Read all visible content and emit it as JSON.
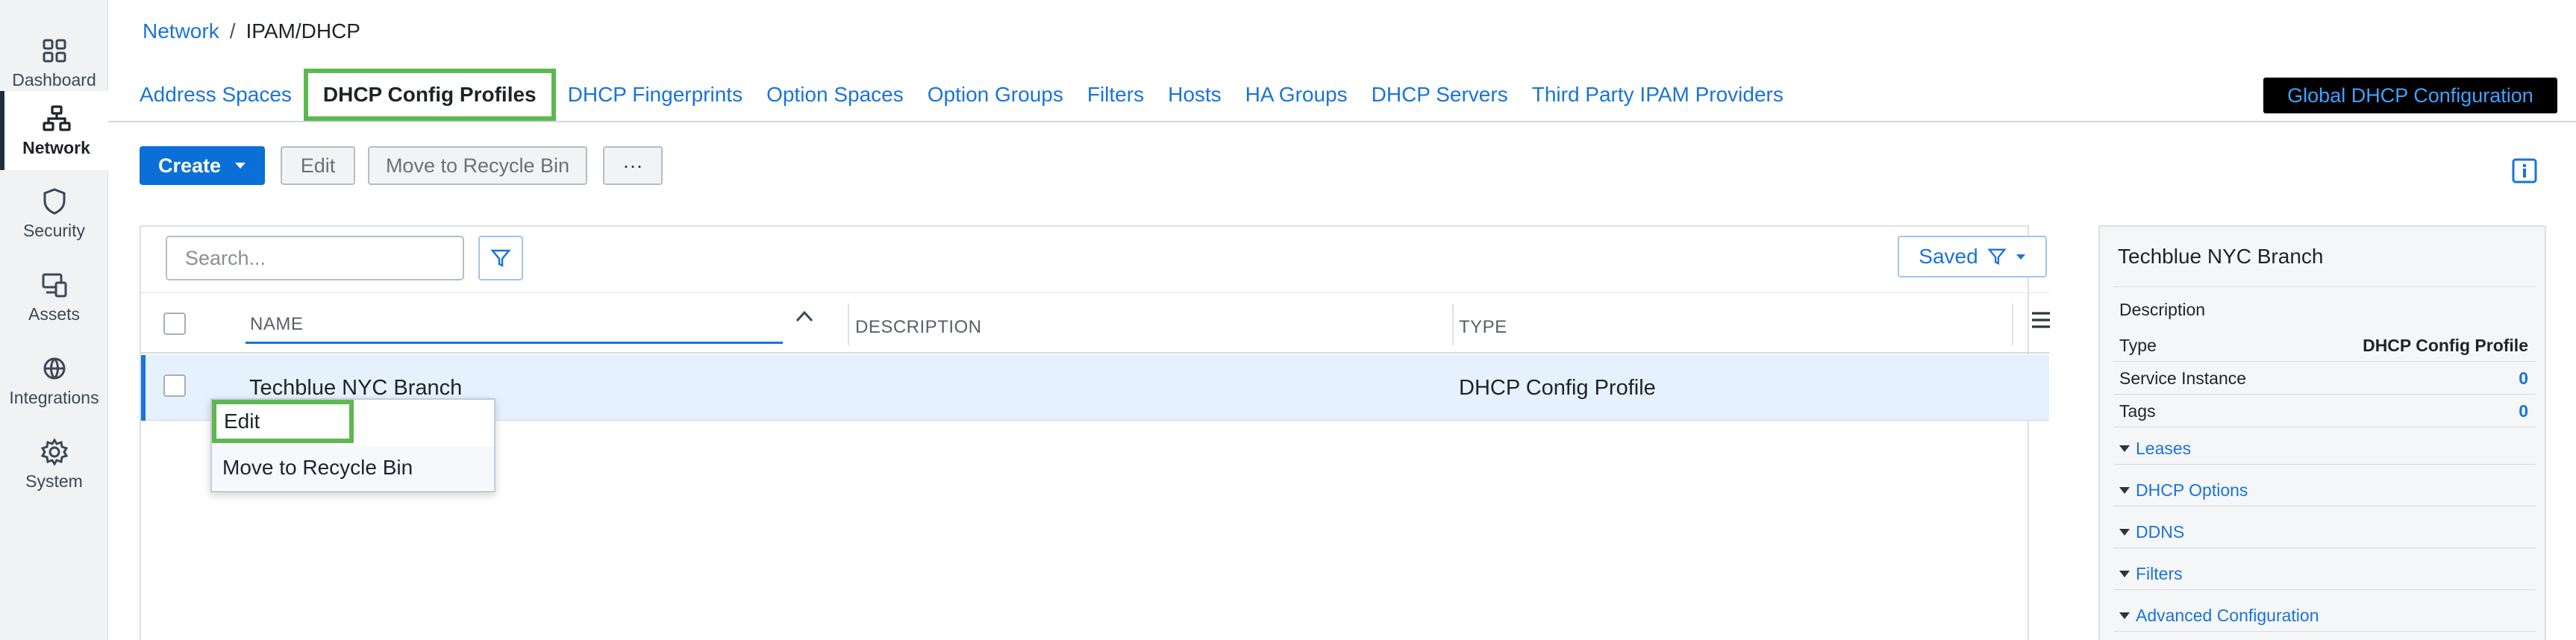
{
  "sidebar": {
    "items": [
      {
        "label": "Dashboard",
        "icon": "grid-icon"
      },
      {
        "label": "Network",
        "icon": "network-icon",
        "active": true
      },
      {
        "label": "Security",
        "icon": "shield-icon"
      },
      {
        "label": "Assets",
        "icon": "assets-icon"
      },
      {
        "label": "Integrations",
        "icon": "integrations-icon"
      },
      {
        "label": "System",
        "icon": "gear-icon"
      }
    ]
  },
  "breadcrumb": {
    "parent": "Network",
    "separator": "/",
    "current": "IPAM/DHCP"
  },
  "tabs": [
    {
      "label": "Address Spaces"
    },
    {
      "label": "DHCP Config Profiles",
      "active": true
    },
    {
      "label": "DHCP Fingerprints"
    },
    {
      "label": "Option Spaces"
    },
    {
      "label": "Option Groups"
    },
    {
      "label": "Filters"
    },
    {
      "label": "Hosts"
    },
    {
      "label": "HA Groups"
    },
    {
      "label": "DHCP Servers"
    },
    {
      "label": "Third Party IPAM Providers"
    }
  ],
  "global_button": "Global DHCP Configuration",
  "toolbar": {
    "create": "Create",
    "edit": "Edit",
    "recycle": "Move to Recycle Bin",
    "more": "···"
  },
  "search": {
    "placeholder": "Search...",
    "saved_label": "Saved"
  },
  "table": {
    "columns": [
      "NAME",
      "DESCRIPTION",
      "TYPE"
    ],
    "rows": [
      {
        "name": "Techblue NYC Branch",
        "description": "",
        "type": "DHCP Config Profile"
      }
    ]
  },
  "context_menu": {
    "items": [
      "Edit",
      "Move to Recycle Bin"
    ]
  },
  "detail": {
    "title": "Techblue NYC Branch",
    "description_label": "Description",
    "fields": [
      {
        "label": "Type",
        "value": "DHCP Config Profile"
      },
      {
        "label": "Service Instance",
        "value": "0"
      },
      {
        "label": "Tags",
        "value": "0"
      }
    ],
    "sections": [
      "Leases",
      "DHCP Options",
      "DDNS",
      "Filters",
      "Advanced Configuration"
    ]
  },
  "colors": {
    "accent": "#1a73d9",
    "highlight": "#5cb84f",
    "selected_row": "#e5f1fc"
  }
}
